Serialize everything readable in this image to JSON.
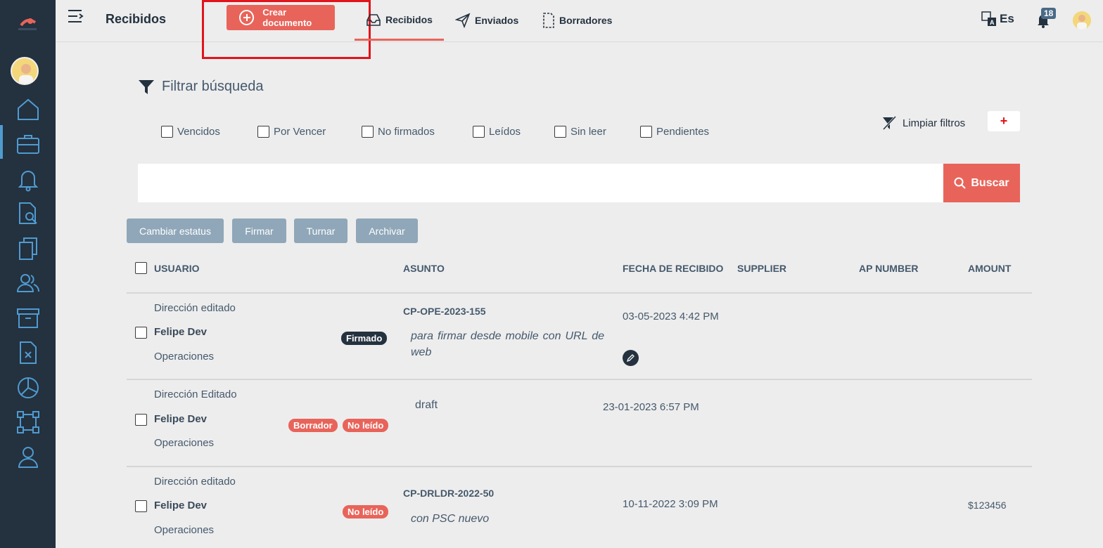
{
  "header": {
    "title": "Recibidos",
    "create_label": "Crear documento",
    "tabs": [
      {
        "label": "Recibidos",
        "icon": "inbox-icon"
      },
      {
        "label": "Enviados",
        "icon": "send-icon"
      },
      {
        "label": "Borradores",
        "icon": "draft-icon"
      }
    ],
    "language": "Es",
    "notifications_count": "18"
  },
  "filter": {
    "title": "Filtrar búsqueda",
    "checkboxes": [
      "Vencidos",
      "Por Vencer",
      "No firmados",
      "Leídos",
      "Sin leer",
      "Pendientes"
    ],
    "clear_label": "Limpiar filtros",
    "add_label": "+"
  },
  "search": {
    "placeholder": "",
    "button_label": "Buscar"
  },
  "actions": [
    "Cambiar estatus",
    "Firmar",
    "Turnar",
    "Archivar"
  ],
  "table": {
    "columns": [
      "USUARIO",
      "ASUNTO",
      "FECHA DE RECIBIDO",
      "SUPPLIER",
      "AP NUMBER",
      "AMOUNT"
    ],
    "rows": [
      {
        "department": "Dirección editado",
        "user": "Felipe Dev",
        "area": "Operaciones",
        "badges": [
          "Firmado"
        ],
        "code": "CP-OPE-2023-155",
        "subject": "para firmar desde mobile con URL de web",
        "date": "03-05-2023 4:42 PM",
        "supplier": "",
        "ap_number": "",
        "amount": ""
      },
      {
        "department": "Dirección Editado",
        "user": "Felipe Dev",
        "area": "Operaciones",
        "badges": [
          "Borrador",
          "No leído"
        ],
        "code": "",
        "subject": "draft",
        "date": "23-01-2023 6:57 PM",
        "supplier": "",
        "ap_number": "",
        "amount": ""
      },
      {
        "department": "Dirección editado",
        "user": "Felipe Dev",
        "area": "Operaciones",
        "badges": [
          "No leído"
        ],
        "code": "CP-DRLDR-2022-50",
        "subject": "con PSC nuevo",
        "date": "10-11-2022 3:09 PM",
        "supplier": "",
        "ap_number": "",
        "amount": "$123456"
      }
    ]
  },
  "colors": {
    "sidebar": "#24313f",
    "accent": "#e8645a",
    "action_buttons": "#8fa7b8",
    "highlight": "#e0141c"
  }
}
